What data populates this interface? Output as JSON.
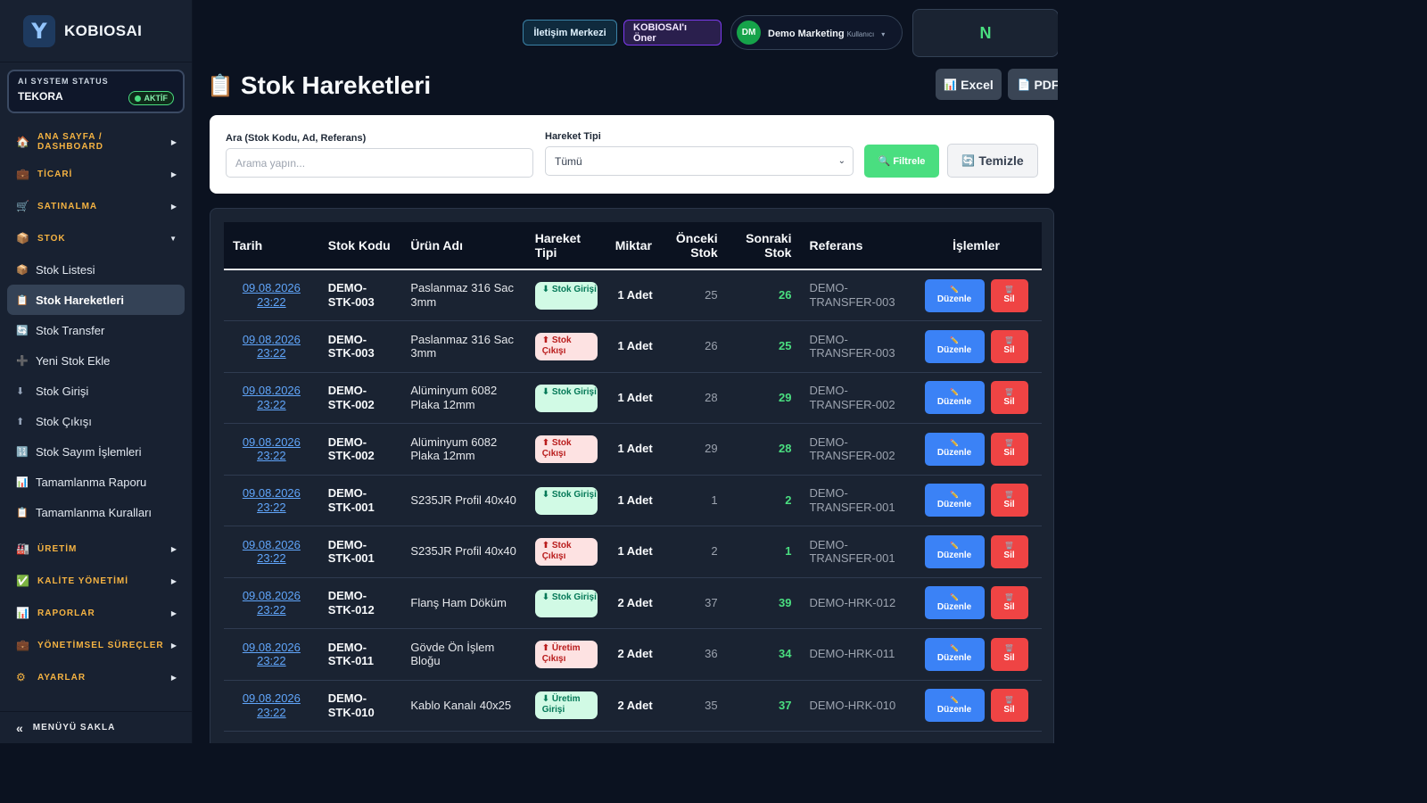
{
  "brand": {
    "logo_letter": "Y",
    "name": "KOBIOSAI"
  },
  "ai_status": {
    "label": "AI SYSTEM STATUS",
    "value": "TEKORA",
    "badge": "AKTİF"
  },
  "sidebar": {
    "sections": [
      {
        "icon": "home-icon",
        "glyph": "🏠",
        "label": "ANA SAYFA / DASHBOARD",
        "arrow": "▶"
      },
      {
        "icon": "briefcase-icon",
        "glyph": "💼",
        "label": "TİCARİ",
        "arrow": "▶"
      },
      {
        "icon": "cart-icon",
        "glyph": "🛒",
        "label": "SATINALMA",
        "arrow": "▶"
      },
      {
        "icon": "box-icon",
        "glyph": "📦",
        "label": "STOK",
        "arrow": "▼"
      }
    ],
    "stok_items": [
      {
        "glyph": "📦",
        "label": "Stok Listesi"
      },
      {
        "glyph": "📋",
        "label": "Stok Hareketleri"
      },
      {
        "glyph": "🔄",
        "label": "Stok Transfer"
      },
      {
        "glyph": "➕",
        "label": "Yeni Stok Ekle"
      },
      {
        "glyph": "⬇",
        "label": "Stok Girişi"
      },
      {
        "glyph": "⬆",
        "label": "Stok Çıkışı"
      },
      {
        "glyph": "🔢",
        "label": "Stok Sayım İşlemleri"
      },
      {
        "glyph": "📊",
        "label": "Tamamlanma Raporu"
      },
      {
        "glyph": "📋",
        "label": "Tamamlanma Kuralları"
      }
    ],
    "sections_after": [
      {
        "glyph": "🏭",
        "label": "ÜRETİM",
        "arrow": "▶"
      },
      {
        "glyph": "✅",
        "label": "KALİTE YÖNETİMİ",
        "arrow": "▶"
      },
      {
        "glyph": "📊",
        "label": "RAPORLAR",
        "arrow": "▶"
      },
      {
        "glyph": "💼",
        "label": "YÖNETİMSEL SÜREÇLER",
        "arrow": "▶"
      },
      {
        "glyph": "⚙",
        "label": "AYARLAR",
        "arrow": "▶"
      }
    ],
    "hide_label": "MENÜYÜ SAKLA",
    "hide_glyph": "«"
  },
  "topbar": {
    "iletisim": "İletişim Merkezi",
    "oner": "KOBIOSAI'ı Öner",
    "user_initials": "DM",
    "user_name": "Demo Marketing",
    "user_role": "Kullanıcı",
    "user_caret": "▾",
    "n_letter": "N"
  },
  "page": {
    "title_glyph": "📋",
    "title": "Stok Hareketleri",
    "excel": "Excel",
    "excel_glyph": "📊",
    "pdf": "PDF",
    "pdf_glyph": "📄"
  },
  "filters": {
    "search_label": "Ara (Stok Kodu, Ad, Referans)",
    "search_placeholder": "Arama yapın...",
    "type_label": "Hareket Tipi",
    "type_value": "Tümü",
    "filter_btn": "🔍 Filtrele",
    "clear_btn": "Temizle",
    "clear_glyph": "🔄"
  },
  "table": {
    "headers": [
      "Tarih",
      "Stok Kodu",
      "Ürün Adı",
      "Hareket Tipi",
      "Miktar",
      "Önceki Stok",
      "Sonraki Stok",
      "Referans",
      "İşlemler"
    ],
    "edit_label": "Düzenle",
    "delete_label": "Sil",
    "rows": [
      {
        "date": "09.08.2026 23:22",
        "code": "DEMO-STK-003",
        "name": "Paslanmaz 316 Sac 3mm",
        "type": "Stok Girişi",
        "kind": "in",
        "qty": "1 Adet",
        "prev": "25",
        "next": "26",
        "ref": "DEMO-TRANSFER-003"
      },
      {
        "date": "09.08.2026 23:22",
        "code": "DEMO-STK-003",
        "name": "Paslanmaz 316 Sac 3mm",
        "type": "Stok Çıkışı",
        "kind": "out",
        "qty": "1 Adet",
        "prev": "26",
        "next": "25",
        "ref": "DEMO-TRANSFER-003"
      },
      {
        "date": "09.08.2026 23:22",
        "code": "DEMO-STK-002",
        "name": "Alüminyum 6082 Plaka 12mm",
        "type": "Stok Girişi",
        "kind": "in",
        "qty": "1 Adet",
        "prev": "28",
        "next": "29",
        "ref": "DEMO-TRANSFER-002"
      },
      {
        "date": "09.08.2026 23:22",
        "code": "DEMO-STK-002",
        "name": "Alüminyum 6082 Plaka 12mm",
        "type": "Stok Çıkışı",
        "kind": "out",
        "qty": "1 Adet",
        "prev": "29",
        "next": "28",
        "ref": "DEMO-TRANSFER-002"
      },
      {
        "date": "09.08.2026 23:22",
        "code": "DEMO-STK-001",
        "name": "S235JR Profil 40x40",
        "type": "Stok Girişi",
        "kind": "in",
        "qty": "1 Adet",
        "prev": "1",
        "next": "2",
        "ref": "DEMO-TRANSFER-001"
      },
      {
        "date": "09.08.2026 23:22",
        "code": "DEMO-STK-001",
        "name": "S235JR Profil 40x40",
        "type": "Stok Çıkışı",
        "kind": "out",
        "qty": "1 Adet",
        "prev": "2",
        "next": "1",
        "ref": "DEMO-TRANSFER-001"
      },
      {
        "date": "09.08.2026 23:22",
        "code": "DEMO-STK-012",
        "name": "Flanş Ham Döküm",
        "type": "Stok Girişi",
        "kind": "in",
        "qty": "2 Adet",
        "prev": "37",
        "next": "39",
        "ref": "DEMO-HRK-012"
      },
      {
        "date": "09.08.2026 23:22",
        "code": "DEMO-STK-011",
        "name": "Gövde Ön İşlem Bloğu",
        "type": "Üretim Çıkışı",
        "kind": "prod-out",
        "qty": "2 Adet",
        "prev": "36",
        "next": "34",
        "ref": "DEMO-HRK-011"
      },
      {
        "date": "09.08.2026 23:22",
        "code": "DEMO-STK-010",
        "name": "Kablo Kanalı 40x25",
        "type": "Üretim Girişi",
        "kind": "prod-in",
        "qty": "2 Adet",
        "prev": "35",
        "next": "37",
        "ref": "DEMO-HRK-010"
      }
    ]
  },
  "colors": {
    "accent_green": "#4ade80",
    "accent_blue": "#3b82f6",
    "danger": "#ef4444",
    "section_amber": "#f5b342"
  }
}
